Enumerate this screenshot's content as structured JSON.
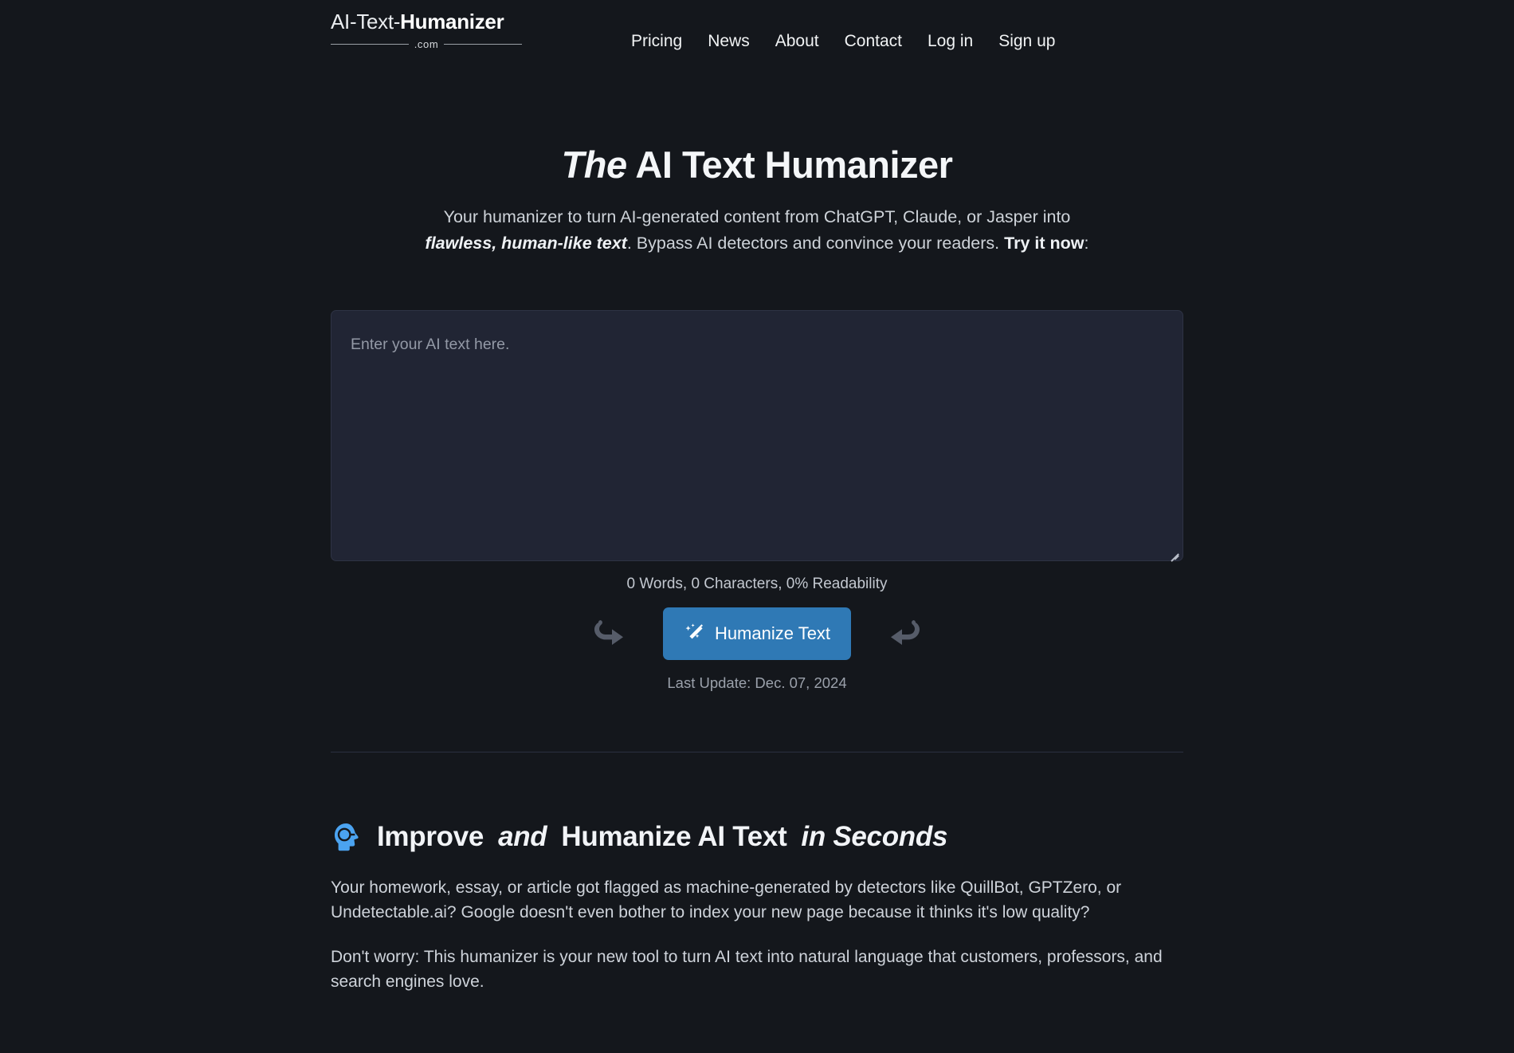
{
  "colors": {
    "page_background": "#14171c",
    "accent_button": "#2f79b5",
    "textarea_background": "#212534",
    "head_icon_blue": "#4ba3f0"
  },
  "header": {
    "logo": {
      "text_light": "AI-Text-",
      "text_bold": "Humanizer",
      "suffix": ".com"
    },
    "nav": [
      {
        "label": "Pricing",
        "name": "nav-pricing"
      },
      {
        "label": "News",
        "name": "nav-news"
      },
      {
        "label": "About",
        "name": "nav-about"
      },
      {
        "label": "Contact",
        "name": "nav-contact"
      },
      {
        "label": "Log in",
        "name": "nav-log-in"
      },
      {
        "label": "Sign up",
        "name": "nav-sign-up"
      }
    ]
  },
  "hero": {
    "title_italic": "The",
    "title_rest": " AI Text Humanizer",
    "subtitle_line1": "Your humanizer to turn AI-generated content from ChatGPT, Claude, or Jasper into",
    "subtitle_emph": "flawless, human-like text",
    "subtitle_line2_mid": ". Bypass AI detectors and convince your readers. ",
    "subtitle_strong": "Try it now",
    "subtitle_end": ":"
  },
  "editor": {
    "placeholder": "Enter your AI text here.",
    "value": "",
    "counter": "0 Words, 0 Characters, 0% Readability",
    "humanize_label": "Humanize Text",
    "last_update": "Last Update: Dec. 07, 2024",
    "redo_icon": "curved-arrow-right-icon",
    "undo_icon": "curved-arrow-left-icon",
    "wand_icon": "magic-wand-icon",
    "resize_handle": "textarea-resize-grip"
  },
  "improve": {
    "icon": "blue-head-profile-icon",
    "heading_p1": "Improve ",
    "heading_and": "and",
    "heading_p2": " Humanize AI Text ",
    "heading_p3": "in Seconds",
    "paragraph1": "Your homework, essay, or article got flagged as machine-generated by detectors like QuillBot, GPTZero, or Undetectable.ai? Google doesn't even bother to index your new page because it thinks it's low quality?",
    "paragraph2": "Don't worry: This humanizer is your new tool to turn AI text into natural language that customers, professors, and search engines love."
  }
}
